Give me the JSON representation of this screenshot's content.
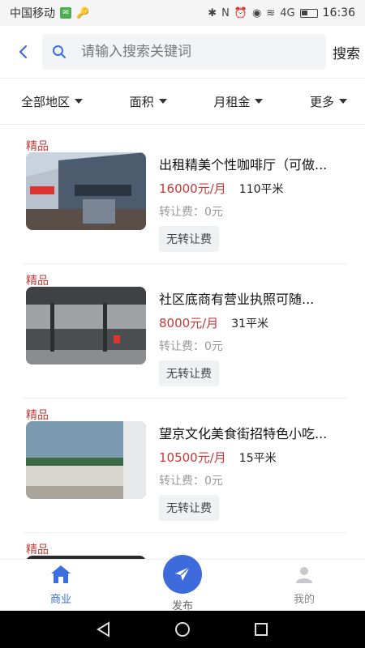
{
  "status_bar": {
    "carrier": "中国移动",
    "time": "16:36",
    "network": "4G"
  },
  "search": {
    "placeholder": "请输入搜索关键词",
    "button_label": "搜索"
  },
  "filters": [
    {
      "label": "全部地区"
    },
    {
      "label": "面积"
    },
    {
      "label": "月租金"
    },
    {
      "label": "更多"
    }
  ],
  "listings": [
    {
      "badge": "精品",
      "title": "出租精美个性咖啡厅（可做...",
      "rent": "16000元/月",
      "area": "110平米",
      "transfer_fee": "转让费：0元",
      "tag": "无转让费"
    },
    {
      "badge": "精品",
      "title": " 社区底商有营业执照可随...",
      "rent": "8000元/月",
      "area": "31平米",
      "transfer_fee": "转让费：0元",
      "tag": "无转让费"
    },
    {
      "badge": "精品",
      "title": "望京文化美食街招特色小吃...",
      "rent": "10500元/月",
      "area": "15平米",
      "transfer_fee": "转让费：0元",
      "tag": "无转让费"
    },
    {
      "badge": "精品"
    }
  ],
  "bottom_nav": {
    "home": "商业",
    "publish": "发布",
    "mine": "我的"
  },
  "colors": {
    "accent": "#3d6bdc",
    "price": "#c23a3a"
  }
}
